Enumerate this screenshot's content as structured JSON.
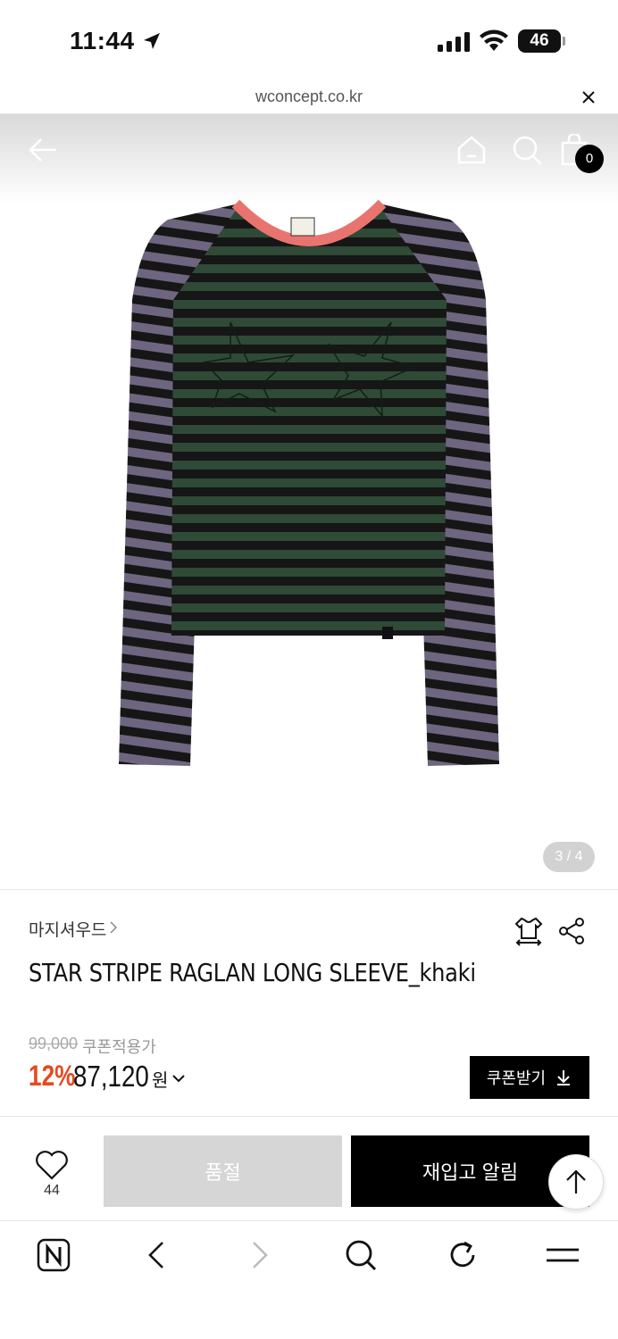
{
  "status": {
    "time": "11:44",
    "battery": "46"
  },
  "browser": {
    "url": "wconcept.co.kr"
  },
  "header": {
    "cart_count": "0"
  },
  "gallery": {
    "pager": "3 / 4",
    "current": 3,
    "total": 4
  },
  "product": {
    "brand": "마지셔우드",
    "title": "STAR STRIPE RAGLAN LONG SLEEVE_khaki",
    "original_price": "99,000",
    "coupon_label": "쿠폰적용가",
    "discount": "12%",
    "price": "87,120",
    "currency": "원",
    "coupon_button": "쿠폰받기"
  },
  "actions": {
    "like_count": "44",
    "soldout_label": "품절",
    "restock_label": "재입고 알림"
  },
  "colors": {
    "discount": "#e8481e",
    "stripe_green": "#2f4a36",
    "stripe_purple": "#6e6580",
    "collar": "#e9746f"
  }
}
